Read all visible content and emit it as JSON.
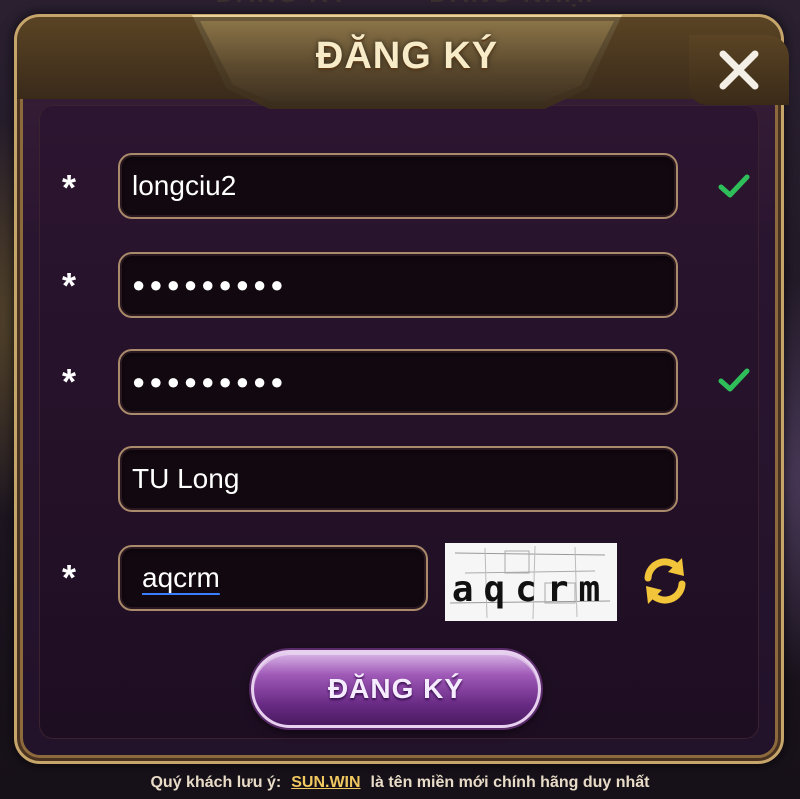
{
  "background": {
    "tabs": [
      "ĐĂNG KÝ",
      "ĐĂNG NHẬP"
    ]
  },
  "dialog": {
    "title": "ĐĂNG KÝ",
    "close_icon": "close-icon"
  },
  "form": {
    "required_mark": "*",
    "username": {
      "value": "longciu2",
      "valid": true
    },
    "password": {
      "value": "●●●●●●●●●",
      "valid": false
    },
    "password_confirm": {
      "value": "●●●●●●●●●",
      "valid": true
    },
    "display_name": {
      "value": "TU Long"
    },
    "captcha": {
      "value": "aqcrm",
      "image_text": "aqcrm"
    }
  },
  "submit": {
    "label": "ĐĂNG KÝ"
  },
  "footer": {
    "prefix": "Quý khách lưu ý:",
    "brand": "SUN.WIN",
    "suffix": "là tên miền mới chính hãng duy nhất"
  },
  "colors": {
    "frame_gold": "#c6a56a",
    "valid_check": "#2fbf5a",
    "submit_purple": "#a05ab8",
    "brand_gold": "#f0c860"
  }
}
